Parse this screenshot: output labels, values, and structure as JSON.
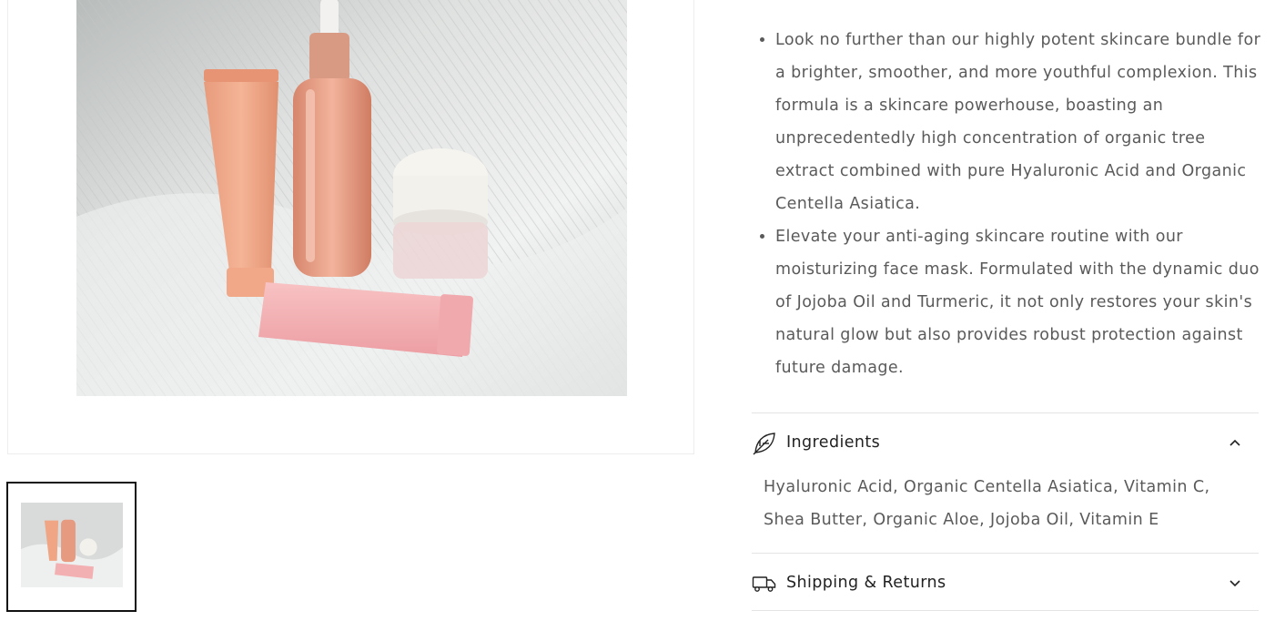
{
  "product": {
    "image_alt": "Skincare products bundle: peach tube, rose gold serum bottle with dropper, white jar cream and pink tube on white pleated fabric"
  },
  "description": {
    "bullets": [
      "Look no further than our highly potent skincare bundle for a brighter, smoother, and more youthful complexion. This formula is a skincare powerhouse, boasting an unprecedentedly high concentration of organic tree extract combined with pure Hyaluronic Acid and Organic Centella Asiatica.",
      "Elevate your anti-aging skincare routine with our moisturizing face mask. Formulated with the dynamic duo of Jojoba Oil and Turmeric, it not only restores your skin's natural glow but also provides robust protection against future damage."
    ]
  },
  "accordions": [
    {
      "title": "Ingredients",
      "icon": "leaf-icon",
      "expanded": true,
      "content": "Hyaluronic Acid, Organic Centella Asiatica, Vitamin C, Shea Butter, Organic Aloe, Jojoba Oil, Vitamin E"
    },
    {
      "title": "Shipping & Returns",
      "icon": "truck-icon",
      "expanded": false
    }
  ],
  "colors": {
    "text": "#5a5a5a",
    "heading": "#222222",
    "border": "#e4e4e4",
    "thumb_border": "#111111"
  }
}
